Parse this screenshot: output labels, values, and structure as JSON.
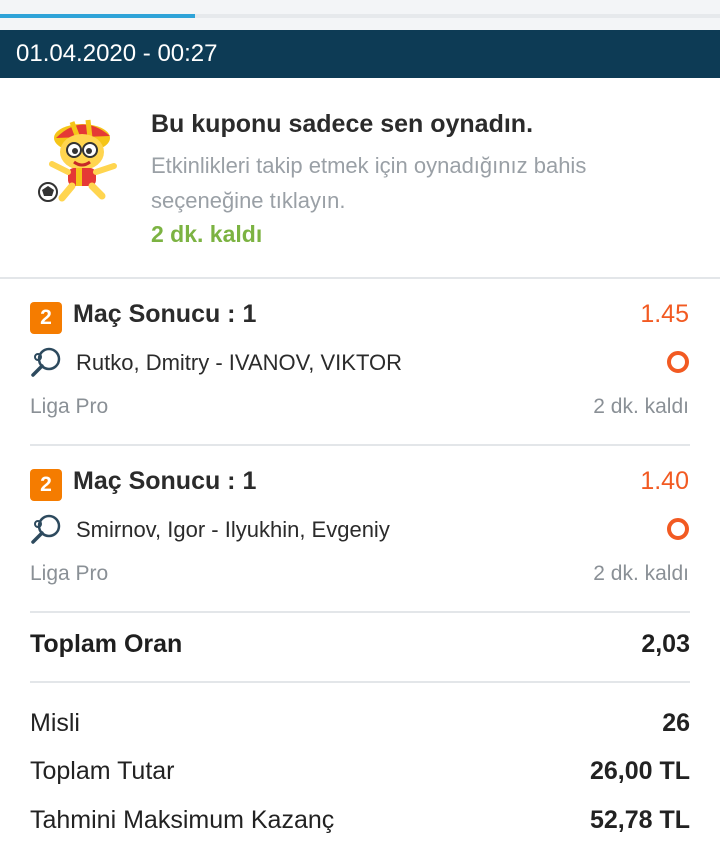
{
  "date_bar": {
    "text": "01.04.2020 - 00:27"
  },
  "info": {
    "title": "Bu kuponu sadece sen oynadın.",
    "description": "Etkinlikleri takip etmek için oynadığınız bahis seçeneğine tıklayın.",
    "time_left": "2 dk. kaldı"
  },
  "bets": [
    {
      "badge": "2",
      "market": "Maç Sonucu : 1",
      "odd": "1.45",
      "teams": "Rutko, Dmitry - IVANOV, VIKTOR",
      "league": "Liga Pro",
      "time_left": "2 dk. kaldı"
    },
    {
      "badge": "2",
      "market": "Maç Sonucu : 1",
      "odd": "1.40",
      "teams": "Smirnov, Igor - Ilyukhin, Evgeniy",
      "league": "Liga Pro",
      "time_left": "2 dk. kaldı"
    }
  ],
  "total": {
    "label": "Toplam Oran",
    "value": "2,03"
  },
  "summary": [
    {
      "label": "Misli",
      "value": "26"
    },
    {
      "label": "Toplam Tutar",
      "value": "26,00 TL"
    },
    {
      "label": "Tahmini Maksimum Kazanç",
      "value": "52,78 TL"
    }
  ],
  "colors": {
    "header_bg": "#0d3b55",
    "accent_blue": "#2ea3d8",
    "odd_orange": "#f25a22",
    "badge_orange": "#f57c00",
    "time_green": "#7cb342"
  },
  "icons": {
    "mascot": "mascot-illustration",
    "sport": "table-tennis-icon",
    "status": "pending-circle-icon"
  }
}
